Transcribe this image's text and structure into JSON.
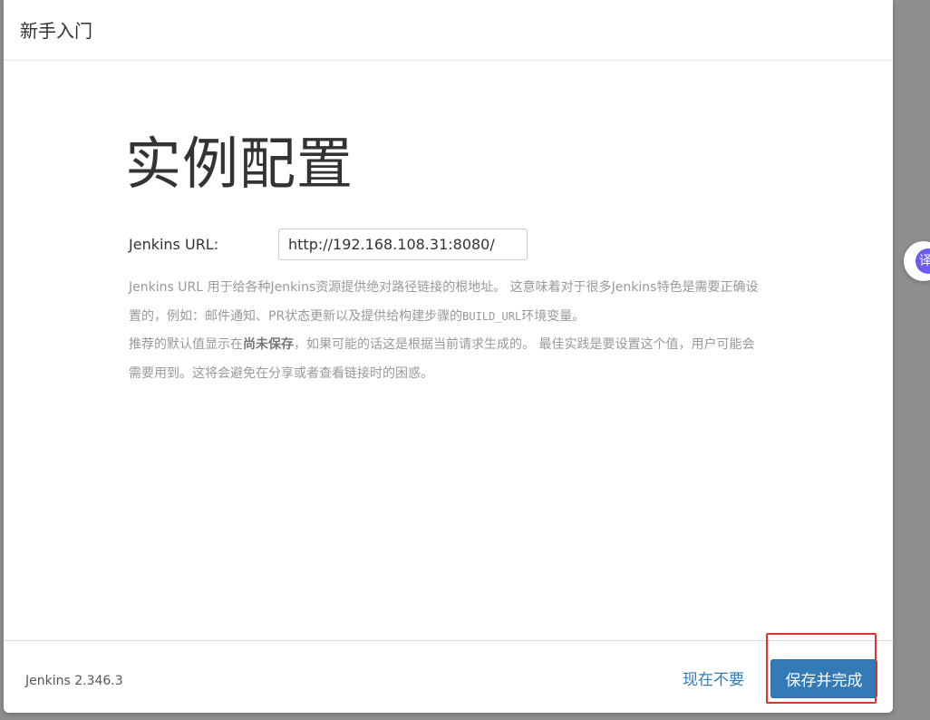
{
  "dialog": {
    "title": "新手入门"
  },
  "page": {
    "heading": "实例配置"
  },
  "form": {
    "url_label": "Jenkins URL:",
    "url_value": "http://192.168.108.31:8080/"
  },
  "help": {
    "line1": "Jenkins URL 用于给各种Jenkins资源提供绝对路径链接的根地址。 这意味着对于很多Jenkins特色是需要正确设置的，例如：邮件通知、PR状态更新以及提供给构建步骤的",
    "code": "BUILD_URL",
    "line1_end": "环境变量。",
    "line2_start": "推荐的默认值显示在",
    "line2_bold": "尚未保存",
    "line2_end": "，如果可能的话这是根据当前请求生成的。 最佳实践是要设置这个值，用户可能会需要用到。这将会避免在分享或者查看链接时的困惑。"
  },
  "footer": {
    "version": "Jenkins 2.346.3",
    "skip_label": "现在不要",
    "save_label": "保存并完成"
  },
  "side_widget": {
    "icon_text": "译",
    "icon_color": "#6a5cf5"
  },
  "colors": {
    "primary": "#337ab7",
    "highlight": "#e5322d"
  }
}
